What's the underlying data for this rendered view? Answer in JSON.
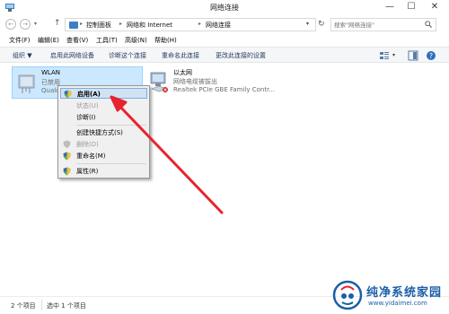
{
  "window": {
    "title": "网络连接",
    "minimize": "—",
    "maximize": "☐",
    "close": "✕"
  },
  "address": {
    "back": "←",
    "forward": "→",
    "up": "↑",
    "breadcrumbs": [
      "控制面板",
      "网络和 Internet",
      "网络连接"
    ],
    "separator": "▸",
    "refresh": "↻",
    "search_placeholder": "搜索\"网络连接\""
  },
  "menu": [
    "文件(F)",
    "编辑(E)",
    "查看(V)",
    "工具(T)",
    "高级(N)",
    "帮助(H)"
  ],
  "toolbar": {
    "organize": "组织 ▼",
    "items": [
      "启用此网络设备",
      "诊断这个连接",
      "重命名此连接",
      "更改此连接的设置"
    ]
  },
  "connections": [
    {
      "name": "WLAN",
      "status": "已禁用",
      "device": "Qualc"
    },
    {
      "name": "以太网",
      "status": "网络电缆被拔出",
      "device": "Realtek PCIe GBE Family Contr..."
    }
  ],
  "context_menu": {
    "items": [
      {
        "label": "启用(A)",
        "bold": true,
        "disabled": false,
        "shield": true,
        "hover": true
      },
      {
        "label": "状态(U)",
        "bold": false,
        "disabled": true,
        "shield": false,
        "hover": false
      },
      {
        "label": "诊断(I)",
        "bold": false,
        "disabled": false,
        "shield": false,
        "hover": false
      },
      {
        "label": "创建快捷方式(S)",
        "bold": false,
        "disabled": false,
        "shield": false,
        "hover": false
      },
      {
        "label": "删除(D)",
        "bold": false,
        "disabled": true,
        "shield": true,
        "hover": false
      },
      {
        "label": "重命名(M)",
        "bold": false,
        "disabled": false,
        "shield": true,
        "hover": false
      },
      {
        "label": "属性(R)",
        "bold": false,
        "disabled": false,
        "shield": true,
        "hover": false
      }
    ]
  },
  "status": {
    "count": "2 个项目",
    "selected": "选中 1 个项目"
  },
  "watermark": {
    "title": "纯净系统家园",
    "url": "www.yidaimei.com"
  },
  "colors": {
    "selection": "#cce8ff",
    "menu_hover": "#d1e2f2",
    "arrow": "#e8232e",
    "link": "#1e395b"
  }
}
